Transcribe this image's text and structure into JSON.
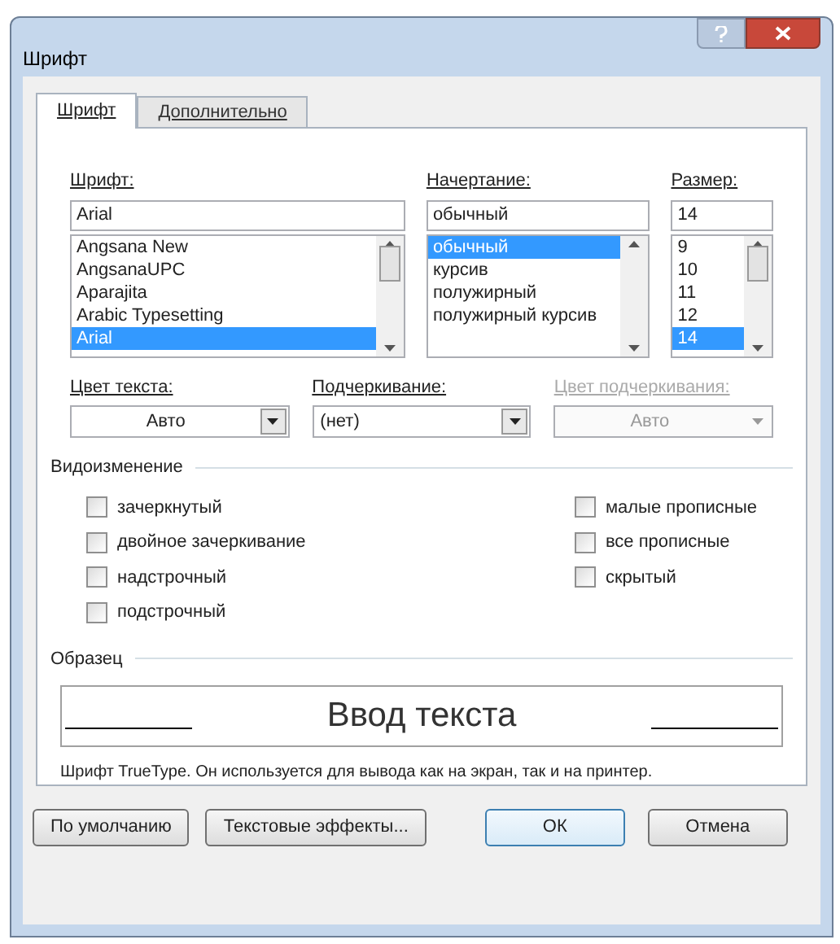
{
  "window": {
    "title": "Шрифт"
  },
  "tabs": [
    {
      "label": "Шрифт",
      "selected": true
    },
    {
      "label": "Дополнительно",
      "selected": false
    }
  ],
  "font": {
    "label": "Шрифт:",
    "value": "Arial",
    "items": [
      {
        "label": "Angsana New",
        "selected": false
      },
      {
        "label": "AngsanaUPC",
        "selected": false
      },
      {
        "label": "Aparajita",
        "selected": false
      },
      {
        "label": "Arabic Typesetting",
        "selected": false
      },
      {
        "label": "Arial",
        "selected": true
      }
    ]
  },
  "style": {
    "label": "Начертание:",
    "value": "обычный",
    "items": [
      {
        "label": "обычный",
        "selected": true
      },
      {
        "label": "курсив",
        "selected": false
      },
      {
        "label": "полужирный",
        "selected": false
      },
      {
        "label": "полужирный курсив",
        "selected": false
      }
    ]
  },
  "size": {
    "label": "Размер:",
    "value": "14",
    "items": [
      {
        "label": "9",
        "selected": false
      },
      {
        "label": "10",
        "selected": false
      },
      {
        "label": "11",
        "selected": false
      },
      {
        "label": "12",
        "selected": false
      },
      {
        "label": "14",
        "selected": true
      }
    ]
  },
  "dropdowns": [
    {
      "label": "Цвет текста:",
      "value": "Авто",
      "disabled": false
    },
    {
      "label": "Подчеркивание:",
      "value": "(нет)",
      "disabled": false
    },
    {
      "label": "Цвет подчеркивания:",
      "value": "Авто",
      "disabled": true
    }
  ],
  "effects": {
    "title": "Видоизменение",
    "left": [
      {
        "label": "зачеркнутый",
        "checked": false
      },
      {
        "label": "двойное зачеркивание",
        "checked": false
      },
      {
        "label": "надстрочный",
        "checked": false
      },
      {
        "label": "подстрочный",
        "checked": false
      }
    ],
    "right": [
      {
        "label": "малые прописные",
        "checked": false
      },
      {
        "label": "все прописные",
        "checked": false
      },
      {
        "label": "скрытый",
        "checked": false
      }
    ]
  },
  "preview": {
    "title": "Образец",
    "sample": "Ввод текста",
    "description": "Шрифт TrueType. Он используется для вывода как на экран, так и на принтер."
  },
  "buttons": [
    {
      "label": "По умолчанию",
      "kind": "default"
    },
    {
      "label": "Текстовые эффекты...",
      "kind": "default"
    },
    {
      "label": "ОК",
      "kind": "primary"
    },
    {
      "label": "Отмена",
      "kind": "default"
    }
  ]
}
